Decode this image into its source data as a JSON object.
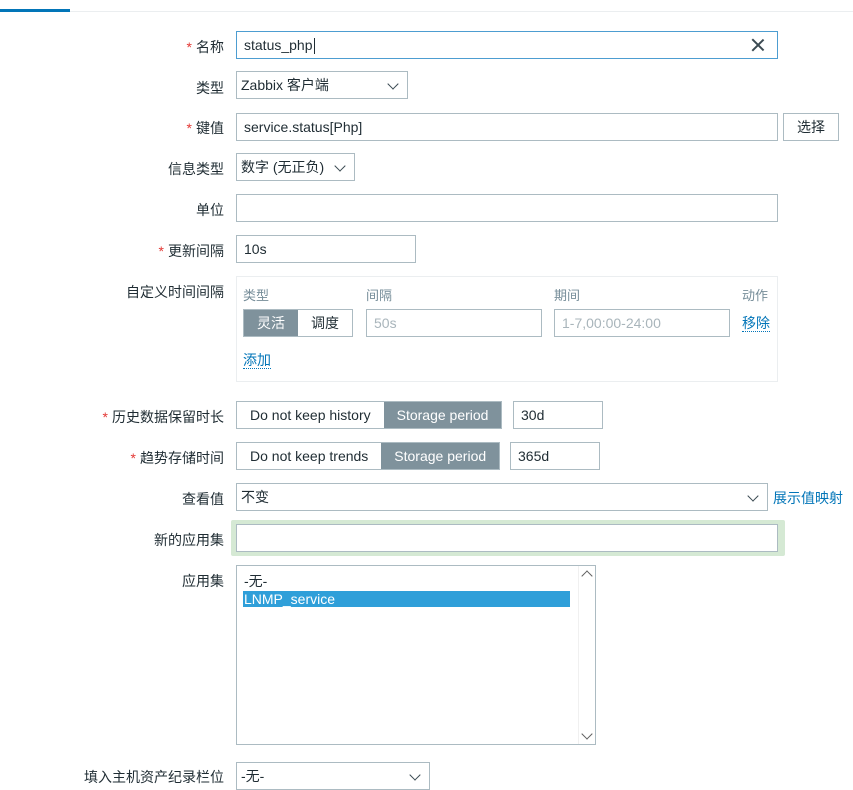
{
  "form": {
    "name": {
      "label": "名称",
      "value": "status_php"
    },
    "type": {
      "label": "类型",
      "value": "Zabbix 客户端"
    },
    "key": {
      "label": "键值",
      "value": "service.status[Php]",
      "select_button": "选择"
    },
    "info_type": {
      "label": "信息类型",
      "value": "数字 (无正负)"
    },
    "units": {
      "label": "单位",
      "value": ""
    },
    "update_interval": {
      "label": "更新间隔",
      "value": "10s"
    },
    "custom_intervals": {
      "label": "自定义时间间隔",
      "headers": {
        "type": "类型",
        "interval": "间隔",
        "period": "期间",
        "action": "动作"
      },
      "row": {
        "mode_flexible": "灵活",
        "mode_scheduling": "调度",
        "interval_placeholder": "50s",
        "period_placeholder": "1-7,00:00-24:00",
        "remove": "移除"
      },
      "add": "添加"
    },
    "history": {
      "label": "历史数据保留时长",
      "option_off": "Do not keep history",
      "option_on": "Storage period",
      "value": "30d"
    },
    "trends": {
      "label": "趋势存储时间",
      "option_off": "Do not keep trends",
      "option_on": "Storage period",
      "value": "365d"
    },
    "show_value": {
      "label": "查看值",
      "value": "不变",
      "link": "展示值映射"
    },
    "new_application": {
      "label": "新的应用集",
      "value": ""
    },
    "applications": {
      "label": "应用集",
      "options": [
        "-无-",
        "LNMP_service"
      ],
      "selected": "LNMP_service"
    },
    "inventory": {
      "label": "填入主机资产纪录栏位",
      "value": "-无-"
    }
  },
  "colors": {
    "accent": "#0275b8",
    "required": "#e33734",
    "selected": "#2f9fd9",
    "segment_on": "#7f929c"
  }
}
